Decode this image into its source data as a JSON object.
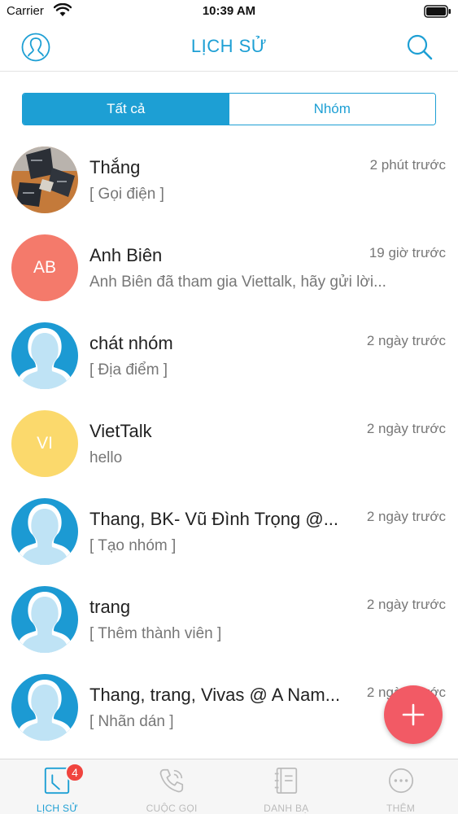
{
  "status_bar": {
    "carrier": "Carrier",
    "time": "10:39 AM"
  },
  "nav": {
    "title": "LỊCH SỬ"
  },
  "segments": [
    {
      "label": "Tất cả",
      "selected": true
    },
    {
      "label": "Nhóm",
      "selected": false
    }
  ],
  "conversations": [
    {
      "name": "Thắng",
      "preview": "[ Gọi điện ]",
      "time": "2 phút trước",
      "avatar": "photo-avatar"
    },
    {
      "name": "Anh Biên",
      "preview": "Anh Biên đã tham gia Viettalk, hãy gửi lời...",
      "time": "19 giờ trước",
      "avatar": "AB",
      "avatar_color": "#f47a6b"
    },
    {
      "name": "chát nhóm",
      "preview": "[ Địa điểm ]",
      "time": "2 ngày trước",
      "avatar": "default-person-icon"
    },
    {
      "name": "VietTalk",
      "preview": "hello",
      "time": "2 ngày trước",
      "avatar": "VI",
      "avatar_color": "#fbd96c"
    },
    {
      "name": "Thang, BK- Vũ Đình Trọng @...",
      "preview": "[ Tạo nhóm ]",
      "time": "2 ngày trước",
      "avatar": "default-person-icon"
    },
    {
      "name": "trang",
      "preview": "[ Thêm thành viên ]",
      "time": "2 ngày trước",
      "avatar": "default-person-icon"
    },
    {
      "name": "Thang, trang, Vivas @ A Nam...",
      "preview": "[ Nhãn dán ]",
      "time": "2 ngày trước",
      "avatar": "default-person-icon"
    }
  ],
  "tabs": [
    {
      "label": "LỊCH SỬ",
      "icon": "history-icon",
      "active": true,
      "badge": "4"
    },
    {
      "label": "CUỘC GỌI",
      "icon": "phone-icon",
      "active": false
    },
    {
      "label": "DANH BẠ",
      "icon": "contacts-book-icon",
      "active": false
    },
    {
      "label": "THÊM",
      "icon": "more-icon",
      "active": false
    }
  ],
  "colors": {
    "accent": "#1d9fd4",
    "fab": "#f25a65",
    "badge": "#f0443e"
  }
}
